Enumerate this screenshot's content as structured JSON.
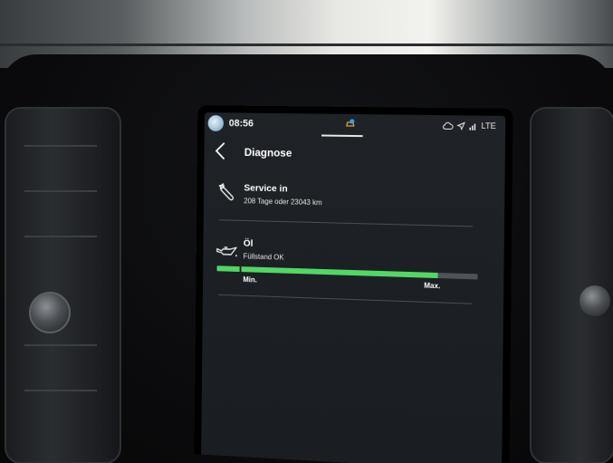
{
  "status_bar": {
    "time": "08:56",
    "network": "LTE",
    "icons": [
      "avatar",
      "connected-car-icon",
      "cloud-sync-icon",
      "location-arrow-icon",
      "signal-icon"
    ]
  },
  "header": {
    "title": "Diagnose",
    "back_icon": "chevron-left-icon"
  },
  "service": {
    "icon": "wrench-icon",
    "title": "Service in",
    "detail": "208 Tage oder 23043 km"
  },
  "oil": {
    "icon": "oil-can-icon",
    "title": "Öl",
    "status": "Füllstand OK",
    "level_fraction": 0.85,
    "min_label": "Min.",
    "max_label": "Max."
  },
  "colors": {
    "accent_green": "#53d763",
    "background": "#1f2327",
    "bar_track": "#4d5358"
  }
}
